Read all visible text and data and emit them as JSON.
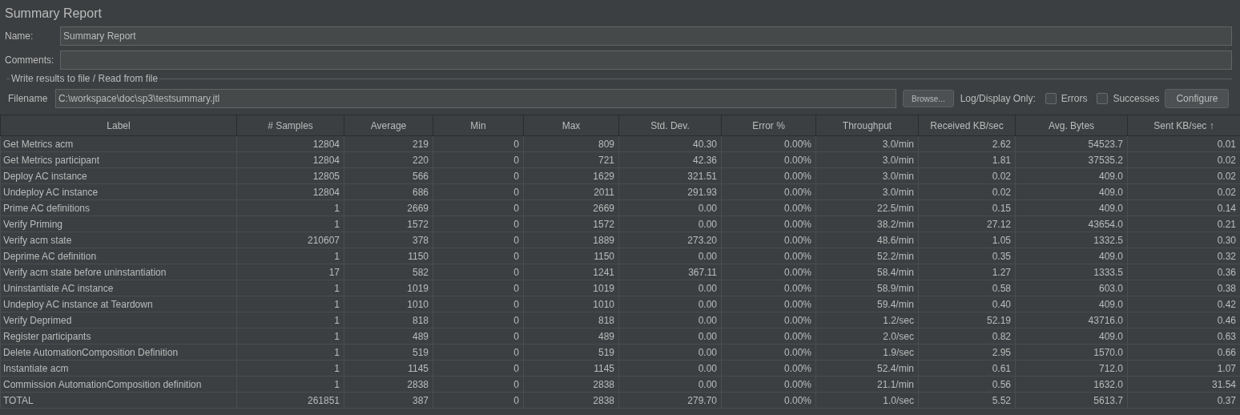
{
  "title": "Summary Report",
  "name_field": {
    "label": "Name:",
    "value": "Summary Report"
  },
  "comments_field": {
    "label": "Comments:"
  },
  "file_group": {
    "legend": "Write results to file / Read from file",
    "filename_label": "Filename",
    "filename": "C:\\workspace\\doc\\sp3\\testsummary.jtl",
    "browse_button": "Browse...",
    "log_display_label": "Log/Display Only:",
    "checkboxes": [
      {
        "label": "Errors",
        "checked": false
      },
      {
        "label": "Successes",
        "checked": false
      }
    ],
    "configure_button": "Configure"
  },
  "table": {
    "columns": [
      "Label",
      "# Samples",
      "Average",
      "Min",
      "Max",
      "Std. Dev.",
      "Error %",
      "Throughput",
      "Received KB/sec",
      "Avg. Bytes",
      "Sent KB/sec ↑"
    ],
    "rows": [
      [
        "Get Metrics acm",
        "12804",
        "219",
        "0",
        "809",
        "40.30",
        "0.00%",
        "3.0/min",
        "2.62",
        "54523.7",
        "0.01"
      ],
      [
        "Get Metrics participant",
        "12804",
        "220",
        "0",
        "721",
        "42.36",
        "0.00%",
        "3.0/min",
        "1.81",
        "37535.2",
        "0.02"
      ],
      [
        "Deploy AC instance",
        "12805",
        "566",
        "0",
        "1629",
        "321.51",
        "0.00%",
        "3.0/min",
        "0.02",
        "409.0",
        "0.02"
      ],
      [
        "Undeploy AC instance",
        "12804",
        "686",
        "0",
        "2011",
        "291.93",
        "0.00%",
        "3.0/min",
        "0.02",
        "409.0",
        "0.02"
      ],
      [
        "Prime AC definitions",
        "1",
        "2669",
        "0",
        "2669",
        "0.00",
        "0.00%",
        "22.5/min",
        "0.15",
        "409.0",
        "0.14"
      ],
      [
        "Verify Priming",
        "1",
        "1572",
        "0",
        "1572",
        "0.00",
        "0.00%",
        "38.2/min",
        "27.12",
        "43654.0",
        "0.21"
      ],
      [
        "Verify acm state",
        "210607",
        "378",
        "0",
        "1889",
        "273.20",
        "0.00%",
        "48.6/min",
        "1.05",
        "1332.5",
        "0.30"
      ],
      [
        "Deprime AC definition",
        "1",
        "1150",
        "0",
        "1150",
        "0.00",
        "0.00%",
        "52.2/min",
        "0.35",
        "409.0",
        "0.32"
      ],
      [
        "Verify acm state before uninstantiation",
        "17",
        "582",
        "0",
        "1241",
        "367.11",
        "0.00%",
        "58.4/min",
        "1.27",
        "1333.5",
        "0.36"
      ],
      [
        "Uninstantiate AC instance",
        "1",
        "1019",
        "0",
        "1019",
        "0.00",
        "0.00%",
        "58.9/min",
        "0.58",
        "603.0",
        "0.38"
      ],
      [
        "Undeploy AC instance at Teardown",
        "1",
        "1010",
        "0",
        "1010",
        "0.00",
        "0.00%",
        "59.4/min",
        "0.40",
        "409.0",
        "0.42"
      ],
      [
        "Verify Deprimed",
        "1",
        "818",
        "0",
        "818",
        "0.00",
        "0.00%",
        "1.2/sec",
        "52.19",
        "43716.0",
        "0.46"
      ],
      [
        "Register participants",
        "1",
        "489",
        "0",
        "489",
        "0.00",
        "0.00%",
        "2.0/sec",
        "0.82",
        "409.0",
        "0.63"
      ],
      [
        "Delete AutomationComposition Definition",
        "1",
        "519",
        "0",
        "519",
        "0.00",
        "0.00%",
        "1.9/sec",
        "2.95",
        "1570.0",
        "0.66"
      ],
      [
        "Instantiate acm",
        "1",
        "1145",
        "0",
        "1145",
        "0.00",
        "0.00%",
        "52.4/min",
        "0.61",
        "712.0",
        "1.07"
      ],
      [
        "Commission AutomationComposition definition",
        "1",
        "2838",
        "0",
        "2838",
        "0.00",
        "0.00%",
        "21.1/min",
        "0.56",
        "1632.0",
        "31.54"
      ],
      [
        "TOTAL",
        "261851",
        "387",
        "0",
        "2838",
        "279.70",
        "0.00%",
        "1.0/sec",
        "5.52",
        "5613.7",
        "0.37"
      ]
    ]
  }
}
